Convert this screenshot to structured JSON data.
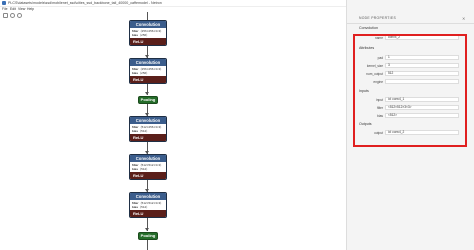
{
  "window": {
    "title": "PLCS\\datasets\\models\\ssd\\mobilenet_ssd\\cities_ssd_backbone_tail_40000_caffemodel - Netron",
    "controls": [
      "–",
      "□",
      "✕"
    ]
  },
  "menu": [
    "File",
    "Edit",
    "View",
    "Help"
  ],
  "graph": {
    "nodes": [
      {
        "type": "Convolution",
        "attrs": [
          {
            "key": "filter",
            "value": "⟨256×256×3×3⟩"
          },
          {
            "key": "bias",
            "value": "⟨256⟩"
          }
        ],
        "activation": "ReLU"
      },
      {
        "type": "Convolution",
        "attrs": [
          {
            "key": "filter",
            "value": "⟨256×256×3×3⟩"
          },
          {
            "key": "bias",
            "value": "⟨256⟩"
          }
        ],
        "activation": "ReLU"
      },
      {
        "type": "Pooling"
      },
      {
        "type": "Convolution",
        "attrs": [
          {
            "key": "filter",
            "value": "⟨512×256×3×3⟩"
          },
          {
            "key": "bias",
            "value": "⟨512⟩"
          }
        ],
        "activation": "ReLU"
      },
      {
        "type": "Convolution",
        "attrs": [
          {
            "key": "filter",
            "value": "⟨512×512×3×3⟩"
          },
          {
            "key": "bias",
            "value": "⟨512⟩"
          }
        ],
        "activation": "ReLU"
      },
      {
        "type": "Convolution",
        "attrs": [
          {
            "key": "filter",
            "value": "⟨512×512×3×3⟩"
          },
          {
            "key": "bias",
            "value": "⟨512⟩"
          }
        ],
        "activation": "ReLU"
      },
      {
        "type": "Pooling"
      }
    ]
  },
  "sidebar": {
    "title": "NODE PROPERTIES",
    "close": "✕",
    "type_value": "Convolution",
    "name_label": "name",
    "name_value": "conv4_2",
    "attributes_title": "Attributes",
    "attributes": [
      {
        "label": "pad",
        "value": "1"
      },
      {
        "label": "kernel_size",
        "value": "3"
      },
      {
        "label": "num_output",
        "value": "512"
      },
      {
        "label": "engine",
        "value": ""
      }
    ],
    "inputs_title": "Inputs",
    "inputs": [
      {
        "label": "input",
        "value": "id: conv4_1"
      },
      {
        "label": "filter",
        "value": "<512×512×3×3>"
      },
      {
        "label": "bias",
        "value": "<512>"
      }
    ],
    "outputs_title": "Outputs",
    "outputs": [
      {
        "label": "output",
        "value": "id: conv4_2"
      }
    ]
  }
}
